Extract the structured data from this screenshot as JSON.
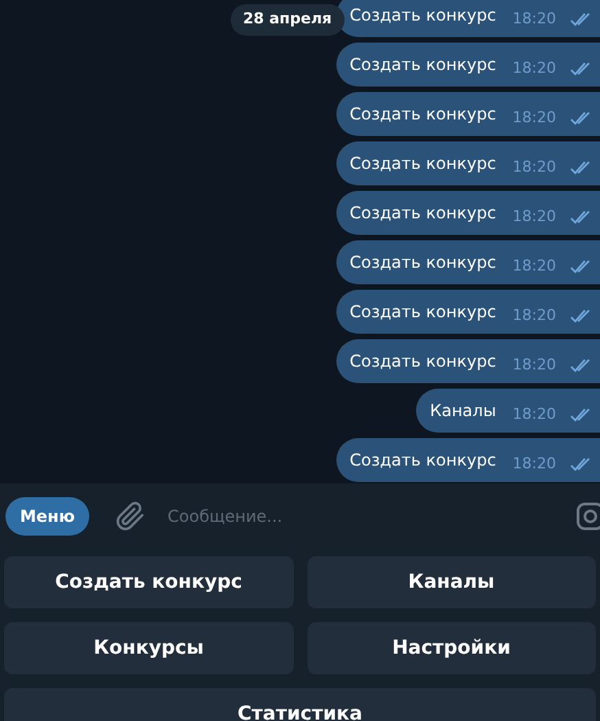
{
  "date_badge": "28 апреля",
  "messages": [
    {
      "text": "Создать конкурс",
      "time": "18:20",
      "read": true
    },
    {
      "text": "Создать конкурс",
      "time": "18:20",
      "read": true
    },
    {
      "text": "Создать конкурс",
      "time": "18:20",
      "read": true
    },
    {
      "text": "Создать конкурс",
      "time": "18:20",
      "read": true
    },
    {
      "text": "Создать конкурс",
      "time": "18:20",
      "read": true
    },
    {
      "text": "Создать конкурс",
      "time": "18:20",
      "read": true
    },
    {
      "text": "Создать конкурс",
      "time": "18:20",
      "read": true
    },
    {
      "text": "Создать конкурс",
      "time": "18:20",
      "read": true
    },
    {
      "text": "Каналы",
      "time": "18:20",
      "read": true
    },
    {
      "text": "Создать конкурс",
      "time": "18:20",
      "read": true
    }
  ],
  "composer": {
    "menu_button": "Меню",
    "placeholder": "Сообщение..."
  },
  "keyboard": [
    [
      "Создать конкурс",
      "Каналы"
    ],
    [
      "Конкурсы",
      "Настройки"
    ],
    [
      "Статистика"
    ]
  ]
}
